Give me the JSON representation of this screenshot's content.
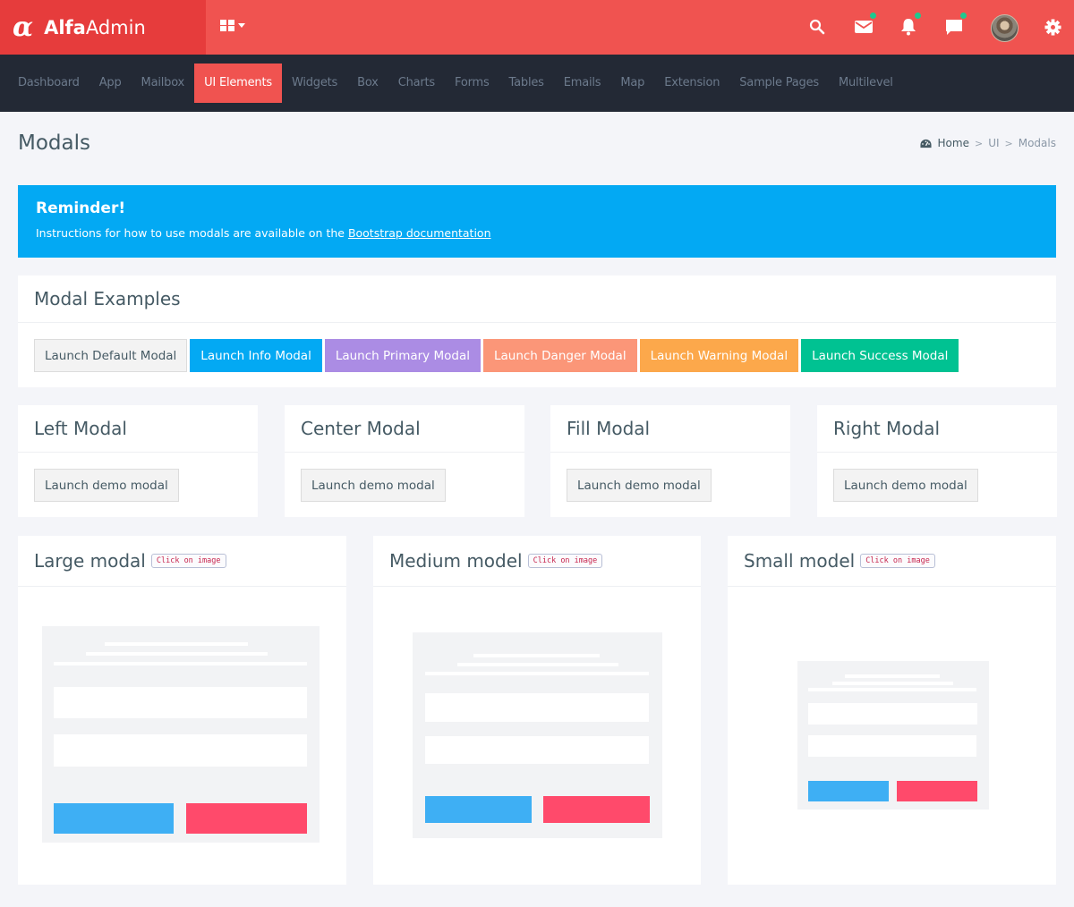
{
  "brand": {
    "logo_glyph": "α",
    "name_bold": "Alfa",
    "name_light": "Admin"
  },
  "header": {
    "apps_icon": "grid-icon",
    "icons": [
      {
        "name": "search-icon",
        "has_dot": false
      },
      {
        "name": "mail-icon",
        "has_dot": true
      },
      {
        "name": "bell-icon",
        "has_dot": true
      },
      {
        "name": "chat-icon",
        "has_dot": true
      },
      {
        "name": "gear-icon",
        "has_dot": false
      }
    ],
    "notification_dot_color": "#1ec98f"
  },
  "nav": {
    "items": [
      "Dashboard",
      "App",
      "Mailbox",
      "UI Elements",
      "Widgets",
      "Box",
      "Charts",
      "Forms",
      "Tables",
      "Emails",
      "Map",
      "Extension",
      "Sample Pages",
      "Multilevel"
    ],
    "active": "UI Elements"
  },
  "page": {
    "title": "Modals",
    "breadcrumb": {
      "home": "Home",
      "parent": "UI",
      "current": "Modals",
      "separator": ">"
    }
  },
  "alert": {
    "title": "Reminder!",
    "text_before": "Instructions for how to use modals are available on the ",
    "link": "Bootstrap documentation",
    "color": "#03a9f3"
  },
  "examples": {
    "title": "Modal Examples",
    "buttons": [
      {
        "label": "Launch Default Modal",
        "variant": "default"
      },
      {
        "label": "Launch Info Modal",
        "variant": "info",
        "color": "#03a9f3"
      },
      {
        "label": "Launch Primary Modal",
        "variant": "primary",
        "color": "#ab8ce4"
      },
      {
        "label": "Launch Danger Modal",
        "variant": "danger",
        "color": "#fb9678"
      },
      {
        "label": "Launch Warning Modal",
        "variant": "warning",
        "color": "#fca84b"
      },
      {
        "label": "Launch Success Modal",
        "variant": "success",
        "color": "#00c292"
      }
    ]
  },
  "position_boxes": [
    {
      "title": "Left Modal",
      "button": "Launch demo modal"
    },
    {
      "title": "Center Modal",
      "button": "Launch demo modal"
    },
    {
      "title": "Fill Modal",
      "button": "Launch demo modal"
    },
    {
      "title": "Right Modal",
      "button": "Launch demo modal"
    }
  ],
  "size_boxes": [
    {
      "title": "Large modal",
      "badge": "Click on image"
    },
    {
      "title": "Medium model",
      "badge": "Click on image"
    },
    {
      "title": "Small model",
      "badge": "Click on image"
    }
  ]
}
